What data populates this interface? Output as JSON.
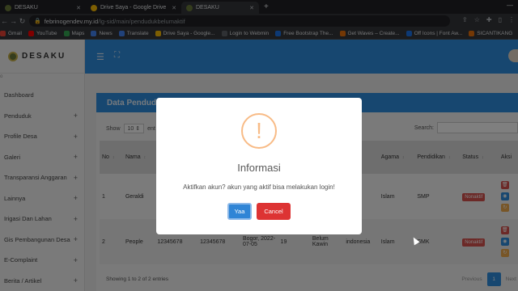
{
  "browser": {
    "tabs": [
      {
        "label": "DESAKU"
      },
      {
        "label": "Drive Saya - Google Drive"
      },
      {
        "label": "DESAKU"
      }
    ],
    "url_host": "febrinogendev.my.id",
    "url_path": "/lg-sid/main/pendudukbelumaktif",
    "bookmarks": [
      {
        "label": "Gmail",
        "color": "#ea4335"
      },
      {
        "label": "YouTube",
        "color": "#ff0000"
      },
      {
        "label": "Maps",
        "color": "#34a853"
      },
      {
        "label": "News",
        "color": "#4285f4"
      },
      {
        "label": "Translate",
        "color": "#4285f4"
      },
      {
        "label": "Drive Saya - Google...",
        "color": "#fbbc04"
      },
      {
        "label": "Login to Webmin",
        "color": "#5f6368"
      },
      {
        "label": "Free Bootstrap The...",
        "color": "#1a73e8"
      },
      {
        "label": "Get Waves – Create...",
        "color": "#e8710a"
      },
      {
        "label": "Off Icons | Font Aw...",
        "color": "#1a73e8"
      },
      {
        "label": "SICANTIKANG",
        "color": "#e8710a"
      }
    ]
  },
  "sidebar": {
    "brand": "DESAKU",
    "items": [
      {
        "label": "Dashboard",
        "expandable": false
      },
      {
        "label": "Penduduk",
        "expandable": true
      },
      {
        "label": "Profile Desa",
        "expandable": true
      },
      {
        "label": "Galeri",
        "expandable": true
      },
      {
        "label": "Transparansi Anggaran",
        "expandable": true
      },
      {
        "label": "Lainnya",
        "expandable": true
      },
      {
        "label": "Irigasi Dan Lahan",
        "expandable": true
      },
      {
        "label": "Gis Pembangunan Desa",
        "expandable": true
      },
      {
        "label": "E-Complaint",
        "expandable": true
      },
      {
        "label": "Berita / Artikel",
        "expandable": true
      }
    ]
  },
  "card": {
    "title": "Data Pendud",
    "show_label": "Show",
    "entries_value": "10",
    "entries_suffix": "ent",
    "search_label": "Search:"
  },
  "table": {
    "headers": [
      "No",
      "Nama",
      "",
      "",
      "",
      "",
      "",
      "a",
      "Agama",
      "Pendidikan",
      "Status",
      "Aksi"
    ],
    "sort_marks": [
      "↕",
      "↕",
      "",
      "",
      "",
      "",
      "",
      "↕",
      "↕",
      "↕",
      "↕",
      ""
    ],
    "rows": [
      {
        "no": "1",
        "nama": "Geraldi",
        "nik": "",
        "kk": "",
        "ttl": "",
        "umur": "",
        "status_kawin": "",
        "kewarganegaraan": "nesia",
        "agama": "Islam",
        "pendidikan": "SMP",
        "status": "Nonaktif"
      },
      {
        "no": "2",
        "nama": "People",
        "nik": "12345678",
        "kk": "12345678",
        "ttl": "Bogor, 2022-07-05",
        "umur": "19",
        "status_kawin": "Belum Kawin",
        "kewarganegaraan": "indonesia",
        "agama": "Islam",
        "pendidikan": "SMK",
        "status": "Nonaktif"
      }
    ],
    "footer": "Showing 1 to 2 of 2 entries",
    "prev": "Previous",
    "page": "1",
    "next": "Next"
  },
  "modal": {
    "icon": "!",
    "title": "Informasi",
    "text": "Aktifkan akun? akun yang aktif bisa melakukan login!",
    "confirm": "Yaa",
    "cancel": "Cancel"
  },
  "colors": {
    "primary": "#2e8fe0",
    "danger": "#d9534f",
    "warning_icon": "#f8bb86"
  }
}
